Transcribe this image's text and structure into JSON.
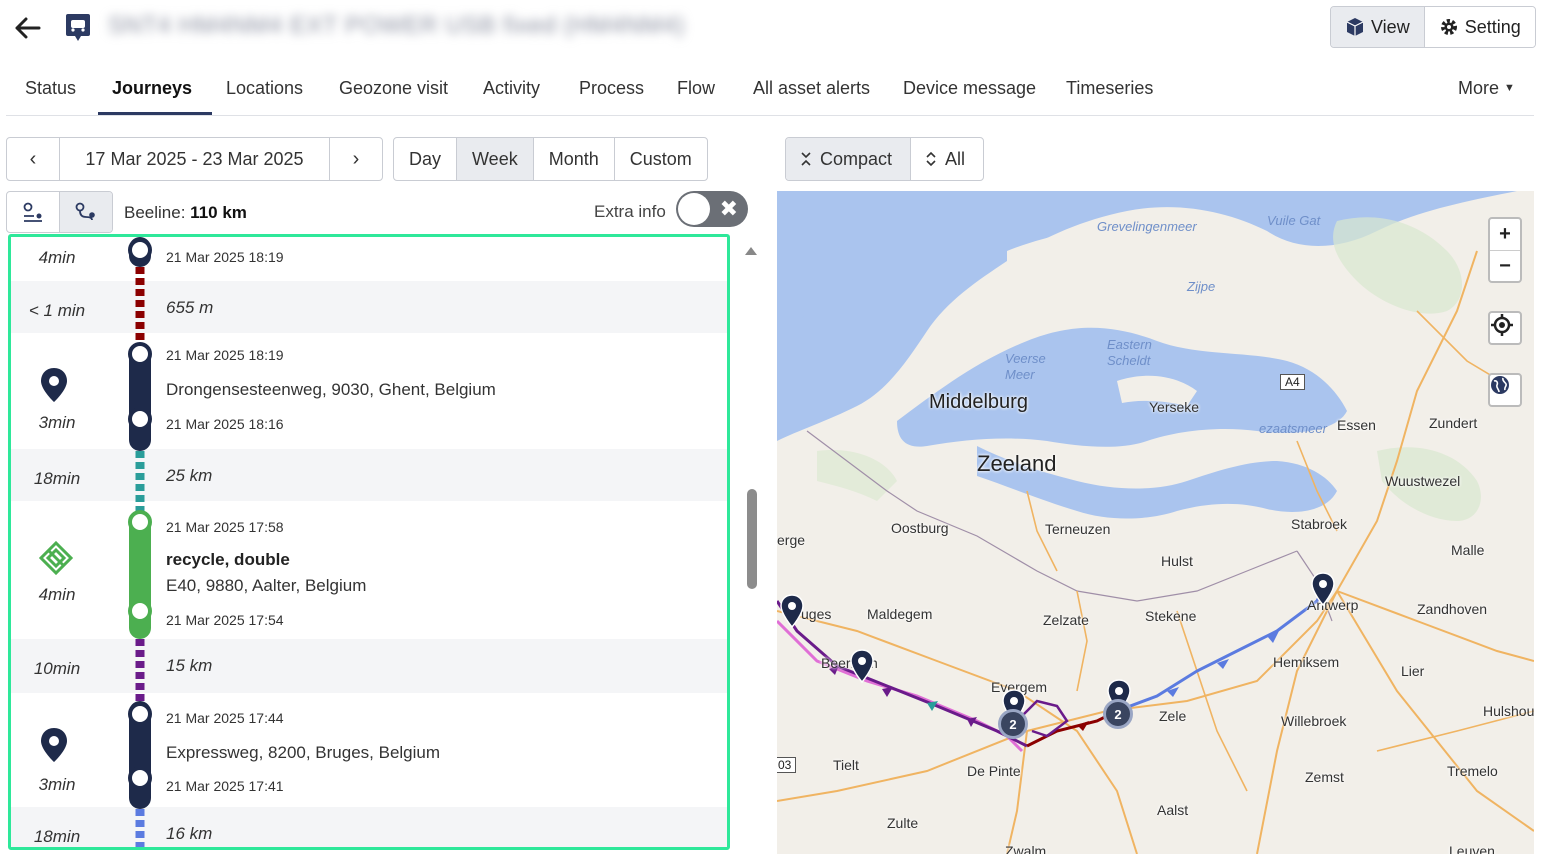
{
  "header": {
    "title": "SNT4 HM4NM4 EXT POWER USB fixed (HM4NM4)",
    "view_label": "View",
    "setting_label": "Setting"
  },
  "tabs": [
    {
      "label": "Status"
    },
    {
      "label": "Journeys"
    },
    {
      "label": "Locations"
    },
    {
      "label": "Geozone visit"
    },
    {
      "label": "Activity"
    },
    {
      "label": "Process"
    },
    {
      "label": "Flow"
    },
    {
      "label": "All asset alerts"
    },
    {
      "label": "Device message"
    },
    {
      "label": "Timeseries"
    },
    {
      "label": "More"
    }
  ],
  "active_tab": "Journeys",
  "date_nav": {
    "prev": "‹",
    "range": "17 Mar 2025 - 23 Mar 2025",
    "next": "›"
  },
  "periods": [
    "Day",
    "Week",
    "Month",
    "Custom"
  ],
  "active_period": "Week",
  "view_modes": {
    "compact": "Compact",
    "all": "All"
  },
  "beeline": {
    "label": "Beeline:",
    "value": "110 km"
  },
  "extra_info": {
    "label": "Extra info",
    "enabled": false
  },
  "journey": {
    "stops": [
      {
        "duration": "4min",
        "end": "21 Mar 2025 18:19"
      },
      {
        "duration": "3min",
        "start": "21 Mar 2025 18:19",
        "address": "Drongensesteenweg, 9030, Ghent, Belgium",
        "end": "21 Mar 2025 18:16",
        "icon": "map-pin-icon"
      },
      {
        "duration": "4min",
        "start": "21 Mar 2025 17:58",
        "name": "recycle, double",
        "address": "E40, 9880, Aalter, Belgium",
        "end": "21 Mar 2025 17:54",
        "icon": "geozone-icon"
      },
      {
        "duration": "3min",
        "start": "21 Mar 2025 17:44",
        "address": "Expressweg, 8200, Bruges, Belgium",
        "end": "21 Mar 2025 17:41",
        "icon": "map-pin-icon"
      }
    ],
    "trips": [
      {
        "duration": "< 1 min",
        "distance": "655 m",
        "color": "#8b0000"
      },
      {
        "duration": "18min",
        "distance": "25 km",
        "color": "#2a9d9a"
      },
      {
        "duration": "10min",
        "distance": "15 km",
        "color": "#6a1b8a"
      },
      {
        "duration": "18min",
        "distance": "16 km",
        "color": "#5b7be0"
      }
    ],
    "colors": {
      "stop": "#1e2a4a",
      "geozone": "#4caf50",
      "highlight": "#2ee89a"
    }
  },
  "map": {
    "labels": {
      "grevelingenmeer": "Grevelingenmeer",
      "vuile_gat": "Vuile Gat",
      "zijpe": "Zijpe",
      "veerse_meer": "Veerse Meer",
      "eastern_scheldt": "Eastern Scheldt",
      "middelburg": "Middelburg",
      "zeeland": "Zeeland",
      "yerseke": "Yerseke",
      "zeeschelde": "ezaatsmeer",
      "essen": "Essen",
      "zundert": "Zundert",
      "wuustwezel": "Wuustwezel",
      "oostburg": "Oostburg",
      "terneuzen": "Terneuzen",
      "stabroek": "Stabroek",
      "malle": "Malle",
      "hulst": "Hulst",
      "erge": "erge",
      "maldegem": "Maldegem",
      "zelzate": "Zelzate",
      "stekene": "Stekene",
      "antwerp": "Antwerp",
      "zandhoven": "Zandhoven",
      "bruges": "Bruges",
      "beernem": "Beernem",
      "hemiksem": "Hemiksem",
      "lier": "Lier",
      "evergem": "Evergem",
      "zele": "Zele",
      "willebroek": "Willebroek",
      "hulshout": "Hulshou",
      "tielt": "Tielt",
      "de_pinte": "De Pinte",
      "zemst": "Zemst",
      "tremelo": "Tremelo",
      "aalst": "Aalst",
      "zulte": "Zulte",
      "zwalm": "Zwalm",
      "leuven": "Leuven",
      "a4": "A4",
      "a03": "03"
    },
    "clusters": [
      "2",
      "2"
    ],
    "zoom_in": "+",
    "zoom_out": "−"
  }
}
